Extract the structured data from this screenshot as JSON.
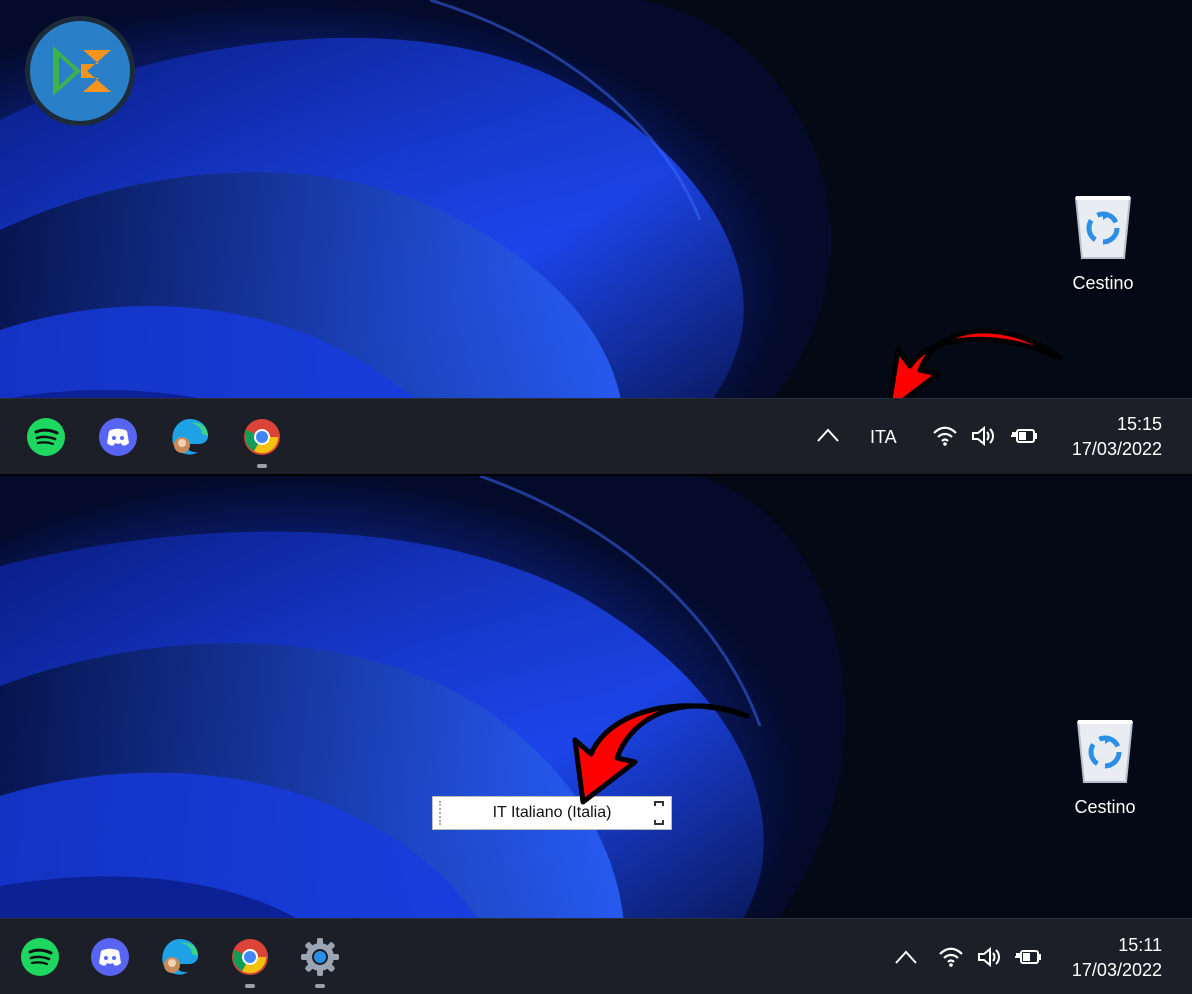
{
  "desktop_icons": {
    "recycle_bin_label": "Cestino"
  },
  "top": {
    "tray": {
      "language": "ITA"
    },
    "clock": {
      "time": "15:15",
      "date": "17/03/2022"
    }
  },
  "bottom": {
    "language_tooltip": {
      "text": "IT  Italiano (Italia)"
    },
    "clock": {
      "time": "15:11",
      "date": "17/03/2022"
    }
  },
  "colors": {
    "taskbar": "#1c1f28",
    "arrow": "#ff0000",
    "spotify": "#1ed760",
    "discord": "#5865f2",
    "logo_blue": "#2a7fc9",
    "logo_green": "#3cb44b",
    "logo_orange": "#f7941d"
  },
  "icons": [
    "logo-icon",
    "recycle-bin-icon",
    "spotify-icon",
    "discord-icon",
    "edge-icon",
    "chrome-icon",
    "settings-icon",
    "chevron-up-icon",
    "wifi-icon",
    "volume-icon",
    "battery-icon",
    "red-arrow-icon"
  ]
}
